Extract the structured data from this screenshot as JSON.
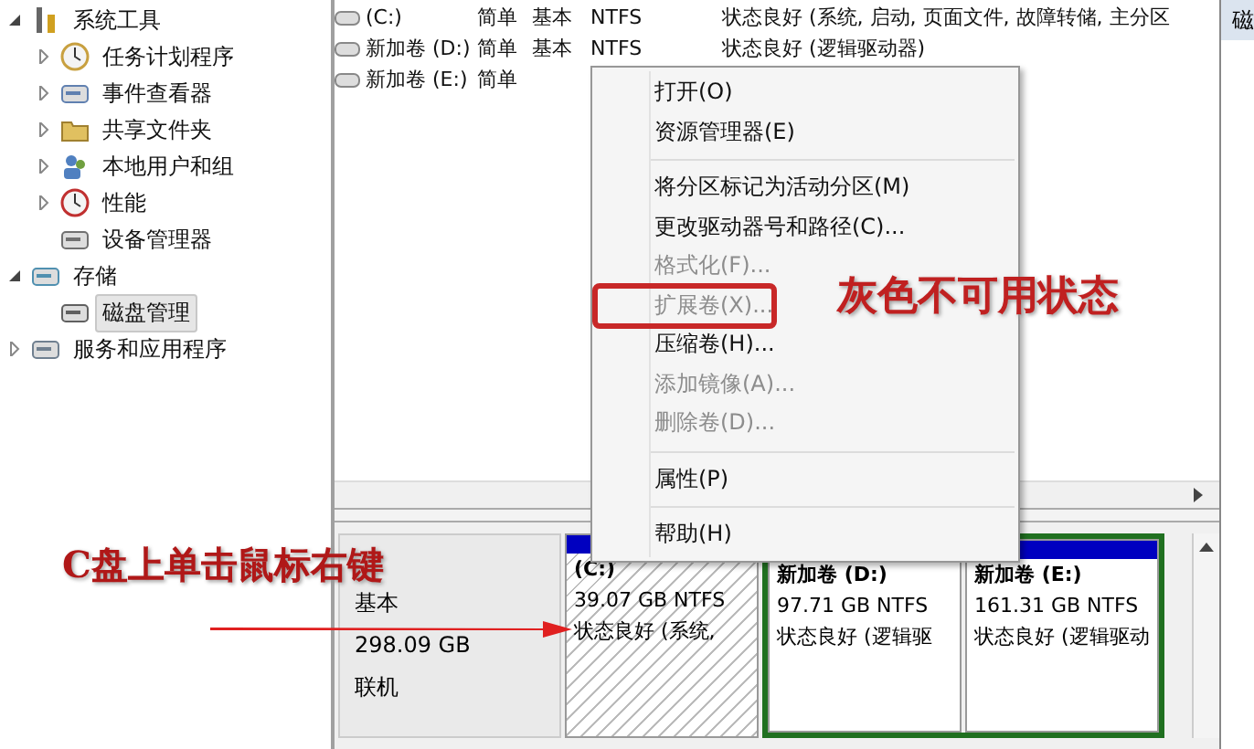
{
  "tree": [
    {
      "label": "系统工具",
      "expanded": true,
      "selected": false,
      "children": [
        {
          "label": "任务计划程序",
          "expanded": false,
          "selected": false
        },
        {
          "label": "事件查看器",
          "expanded": false,
          "selected": false
        },
        {
          "label": "共享文件夹",
          "expanded": false,
          "selected": false
        },
        {
          "label": "本地用户和组",
          "expanded": false,
          "selected": false
        },
        {
          "label": "性能",
          "expanded": false,
          "selected": false
        },
        {
          "label": "设备管理器",
          "selected": false
        }
      ]
    },
    {
      "label": "存储",
      "expanded": true,
      "selected": false,
      "children": [
        {
          "label": "磁盘管理",
          "selected": true
        }
      ]
    },
    {
      "label": "服务和应用程序",
      "expanded": false,
      "selected": false
    }
  ],
  "volumes": [
    {
      "name": "(C:)",
      "layout": "简单",
      "type": "基本",
      "fs": "NTFS",
      "status": "状态良好 (系统, 启动, 页面文件, 故障转储, 主分区"
    },
    {
      "name": "新加卷 (D:)",
      "layout": "简单",
      "type": "基本",
      "fs": "NTFS",
      "status": "状态良好 (逻辑驱动器)"
    },
    {
      "name": "新加卷 (E:)",
      "layout": "简单"
    }
  ],
  "disk": {
    "type": "基本",
    "size": "298.09 GB",
    "state": "联机",
    "partitions": [
      {
        "kind": "primary",
        "label": "(C:)",
        "size": "39.07 GB NTFS",
        "status": "状态良好 (系统,"
      },
      {
        "kind": "logical",
        "label": "新加卷  (D:)",
        "size": "97.71 GB NTFS",
        "status": "状态良好 (逻辑驱"
      },
      {
        "kind": "logical",
        "label": "新加卷  (E:)",
        "size": "161.31 GB NTFS",
        "status": "状态良好 (逻辑驱动"
      }
    ]
  },
  "action_pane": {
    "title": "磁"
  },
  "context_menu": [
    {
      "kind": "item",
      "label": "打开(O)",
      "disabled": false
    },
    {
      "kind": "item",
      "label": "资源管理器(E)",
      "disabled": false
    },
    {
      "kind": "separator"
    },
    {
      "kind": "item",
      "label": "将分区标记为活动分区(M)",
      "disabled": false
    },
    {
      "kind": "item",
      "label": "更改驱动器号和路径(C)...",
      "disabled": false
    },
    {
      "kind": "item",
      "label": "格式化(F)...",
      "disabled": true
    },
    {
      "kind": "item",
      "label": "扩展卷(X)...",
      "disabled": true,
      "highlighted": true
    },
    {
      "kind": "item",
      "label": "压缩卷(H)...",
      "disabled": false
    },
    {
      "kind": "item",
      "label": "添加镜像(A)...",
      "disabled": true
    },
    {
      "kind": "item",
      "label": "删除卷(D)...",
      "disabled": true
    },
    {
      "kind": "separator"
    },
    {
      "kind": "item",
      "label": "属性(P)",
      "disabled": false
    },
    {
      "kind": "separator"
    },
    {
      "kind": "item",
      "label": "帮助(H)",
      "disabled": false
    }
  ],
  "annotations": [
    {
      "kind": "callout",
      "text": "灰色不可用状态"
    },
    {
      "kind": "pointer",
      "text": "C盘上单击鼠标右键"
    }
  ]
}
